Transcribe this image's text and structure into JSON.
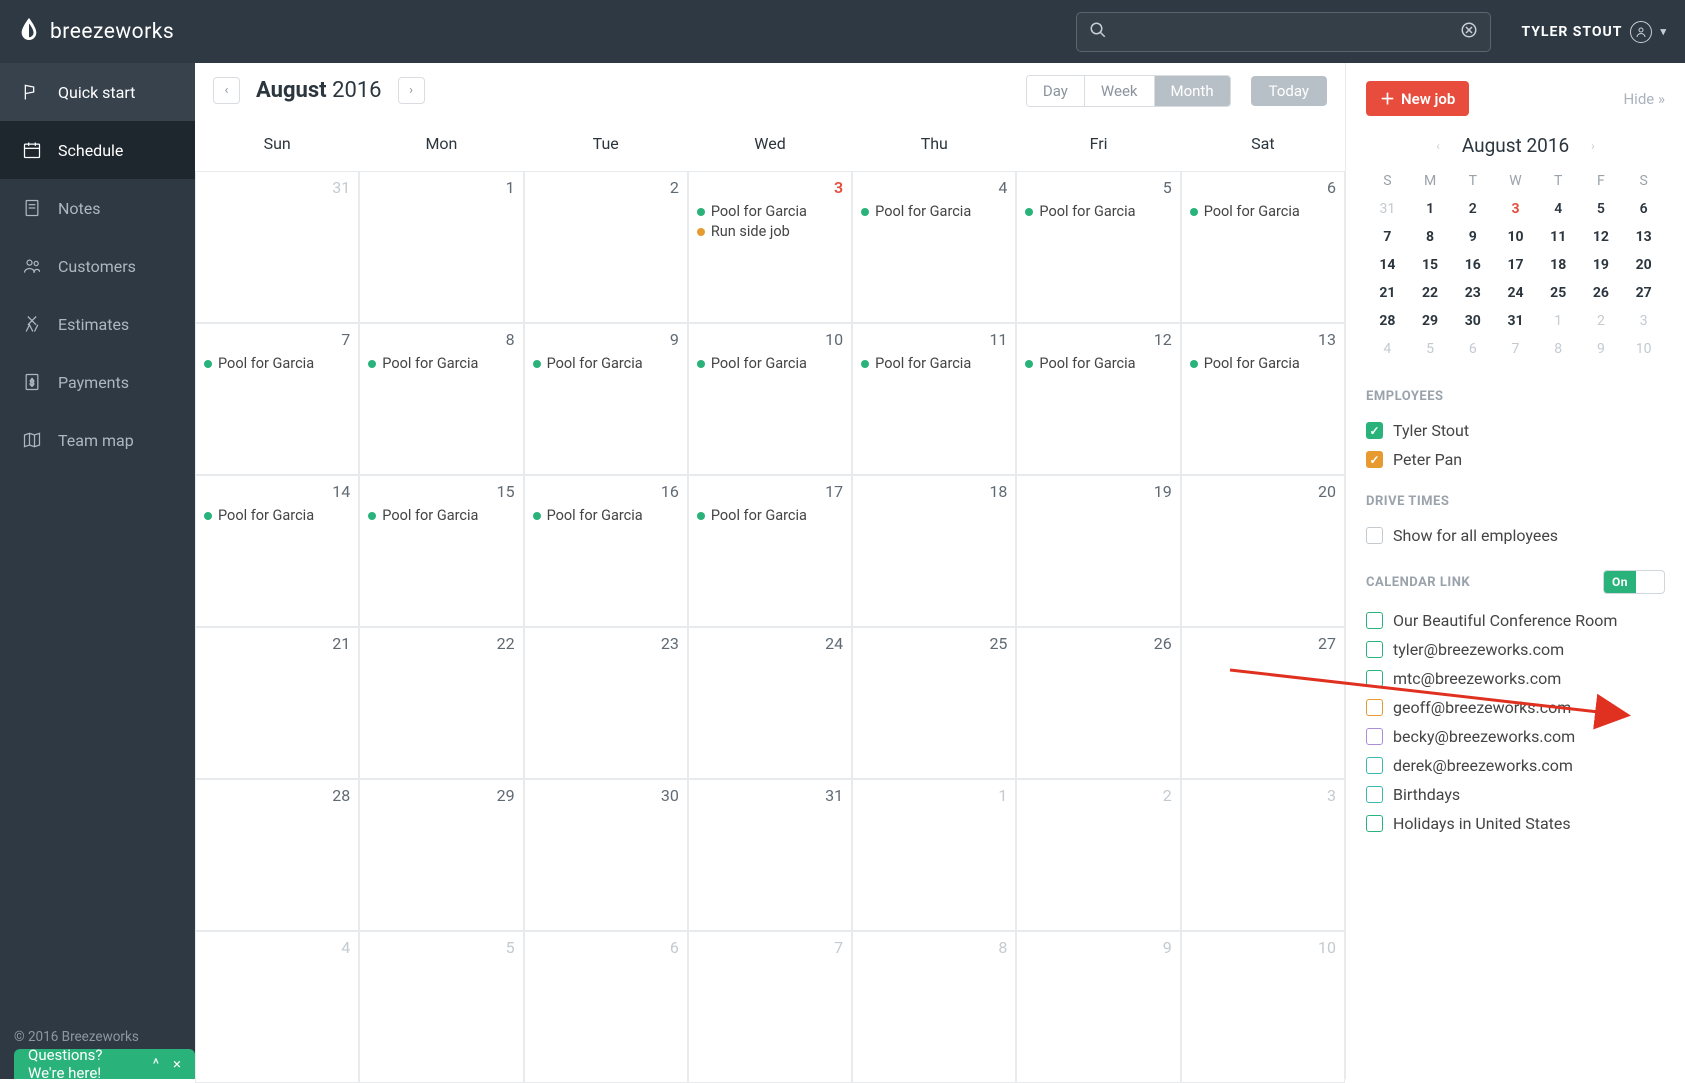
{
  "brand": "breezeworks",
  "search": {
    "placeholder": ""
  },
  "user_name": "TYLER STOUT",
  "copyright": "© 2016 Breezeworks",
  "questions_label": "Questions? We're here!",
  "sidebar": {
    "items": [
      {
        "label": "Quick start"
      },
      {
        "label": "Schedule"
      },
      {
        "label": "Notes"
      },
      {
        "label": "Customers"
      },
      {
        "label": "Estimates"
      },
      {
        "label": "Payments"
      },
      {
        "label": "Team map"
      }
    ]
  },
  "calendar": {
    "month": "August",
    "year": "2016",
    "views": [
      "Day",
      "Week",
      "Month"
    ],
    "active_view": "Month",
    "today_label": "Today",
    "day_headers": [
      "Sun",
      "Mon",
      "Tue",
      "Wed",
      "Thu",
      "Fri",
      "Sat"
    ],
    "cells": [
      {
        "n": "31",
        "out": true
      },
      {
        "n": "1"
      },
      {
        "n": "2"
      },
      {
        "n": "3",
        "today": true,
        "events": [
          {
            "c": "green",
            "t": "Pool for Garcia"
          },
          {
            "c": "orange",
            "t": "Run side job"
          }
        ]
      },
      {
        "n": "4",
        "events": [
          {
            "c": "green",
            "t": "Pool for Garcia"
          }
        ]
      },
      {
        "n": "5",
        "events": [
          {
            "c": "green",
            "t": "Pool for Garcia"
          }
        ]
      },
      {
        "n": "6",
        "events": [
          {
            "c": "green",
            "t": "Pool for Garcia"
          }
        ]
      },
      {
        "n": "7",
        "events": [
          {
            "c": "green",
            "t": "Pool for Garcia"
          }
        ]
      },
      {
        "n": "8",
        "events": [
          {
            "c": "green",
            "t": "Pool for Garcia"
          }
        ]
      },
      {
        "n": "9",
        "events": [
          {
            "c": "green",
            "t": "Pool for Garcia"
          }
        ]
      },
      {
        "n": "10",
        "events": [
          {
            "c": "green",
            "t": "Pool for Garcia"
          }
        ]
      },
      {
        "n": "11",
        "events": [
          {
            "c": "green",
            "t": "Pool for Garcia"
          }
        ]
      },
      {
        "n": "12",
        "events": [
          {
            "c": "green",
            "t": "Pool for Garcia"
          }
        ]
      },
      {
        "n": "13",
        "events": [
          {
            "c": "green",
            "t": "Pool for Garcia"
          }
        ]
      },
      {
        "n": "14",
        "events": [
          {
            "c": "green",
            "t": "Pool for Garcia"
          }
        ]
      },
      {
        "n": "15",
        "events": [
          {
            "c": "green",
            "t": "Pool for Garcia"
          }
        ]
      },
      {
        "n": "16",
        "events": [
          {
            "c": "green",
            "t": "Pool for Garcia"
          }
        ]
      },
      {
        "n": "17",
        "events": [
          {
            "c": "green",
            "t": "Pool for Garcia"
          }
        ]
      },
      {
        "n": "18"
      },
      {
        "n": "19"
      },
      {
        "n": "20"
      },
      {
        "n": "21"
      },
      {
        "n": "22"
      },
      {
        "n": "23"
      },
      {
        "n": "24"
      },
      {
        "n": "25"
      },
      {
        "n": "26"
      },
      {
        "n": "27"
      },
      {
        "n": "28"
      },
      {
        "n": "29"
      },
      {
        "n": "30"
      },
      {
        "n": "31"
      },
      {
        "n": "1",
        "out": true
      },
      {
        "n": "2",
        "out": true
      },
      {
        "n": "3",
        "out": true
      },
      {
        "n": "4",
        "out": true
      },
      {
        "n": "5",
        "out": true
      },
      {
        "n": "6",
        "out": true
      },
      {
        "n": "7",
        "out": true
      },
      {
        "n": "8",
        "out": true
      },
      {
        "n": "9",
        "out": true
      },
      {
        "n": "10",
        "out": true
      }
    ]
  },
  "panel": {
    "new_job": "New job",
    "hide": "Hide",
    "mini": {
      "title": "August 2016",
      "dh": [
        "S",
        "M",
        "T",
        "W",
        "T",
        "F",
        "S"
      ],
      "rows": [
        [
          {
            "n": "31",
            "out": true
          },
          {
            "n": "1"
          },
          {
            "n": "2"
          },
          {
            "n": "3",
            "today": true
          },
          {
            "n": "4"
          },
          {
            "n": "5"
          },
          {
            "n": "6"
          }
        ],
        [
          {
            "n": "7",
            "b": true
          },
          {
            "n": "8",
            "b": true
          },
          {
            "n": "9",
            "b": true
          },
          {
            "n": "10",
            "b": true
          },
          {
            "n": "11",
            "b": true
          },
          {
            "n": "12",
            "b": true
          },
          {
            "n": "13",
            "b": true
          }
        ],
        [
          {
            "n": "14",
            "b": true
          },
          {
            "n": "15",
            "b": true
          },
          {
            "n": "16",
            "b": true
          },
          {
            "n": "17",
            "b": true
          },
          {
            "n": "18",
            "b": true
          },
          {
            "n": "19",
            "b": true
          },
          {
            "n": "20",
            "b": true
          }
        ],
        [
          {
            "n": "21",
            "b": true
          },
          {
            "n": "22",
            "b": true
          },
          {
            "n": "23",
            "b": true
          },
          {
            "n": "24",
            "b": true
          },
          {
            "n": "25",
            "b": true
          },
          {
            "n": "26",
            "b": true
          },
          {
            "n": "27",
            "b": true
          }
        ],
        [
          {
            "n": "28",
            "b": true
          },
          {
            "n": "29",
            "b": true
          },
          {
            "n": "30",
            "b": true
          },
          {
            "n": "31",
            "b": true
          },
          {
            "n": "1",
            "out": true
          },
          {
            "n": "2",
            "out": true
          },
          {
            "n": "3",
            "out": true
          }
        ],
        [
          {
            "n": "4",
            "out": true
          },
          {
            "n": "5",
            "out": true
          },
          {
            "n": "6",
            "out": true
          },
          {
            "n": "7",
            "out": true
          },
          {
            "n": "8",
            "out": true
          },
          {
            "n": "9",
            "out": true
          },
          {
            "n": "10",
            "out": true
          }
        ]
      ]
    },
    "employees_title": "EMPLOYEES",
    "employees": [
      {
        "name": "Tyler Stout",
        "cls": "filled-green"
      },
      {
        "name": "Peter Pan",
        "cls": "filled-orange"
      }
    ],
    "drive_title": "DRIVE TIMES",
    "drive_option": "Show for all employees",
    "callink_title": "CALENDAR LINK",
    "toggle_label": "On",
    "calendars": [
      {
        "name": "Our Beautiful Conference Room",
        "cls": "outline-green"
      },
      {
        "name": "tyler@breezeworks.com",
        "cls": "outline-green"
      },
      {
        "name": "mtc@breezeworks.com",
        "cls": "outline-green"
      },
      {
        "name": "geoff@breezeworks.com",
        "cls": "outline-orange"
      },
      {
        "name": "becky@breezeworks.com",
        "cls": "outline-purple"
      },
      {
        "name": "derek@breezeworks.com",
        "cls": "outline-teal"
      },
      {
        "name": "Birthdays",
        "cls": "outline-teal"
      },
      {
        "name": "Holidays in United States",
        "cls": "outline-green"
      }
    ]
  }
}
